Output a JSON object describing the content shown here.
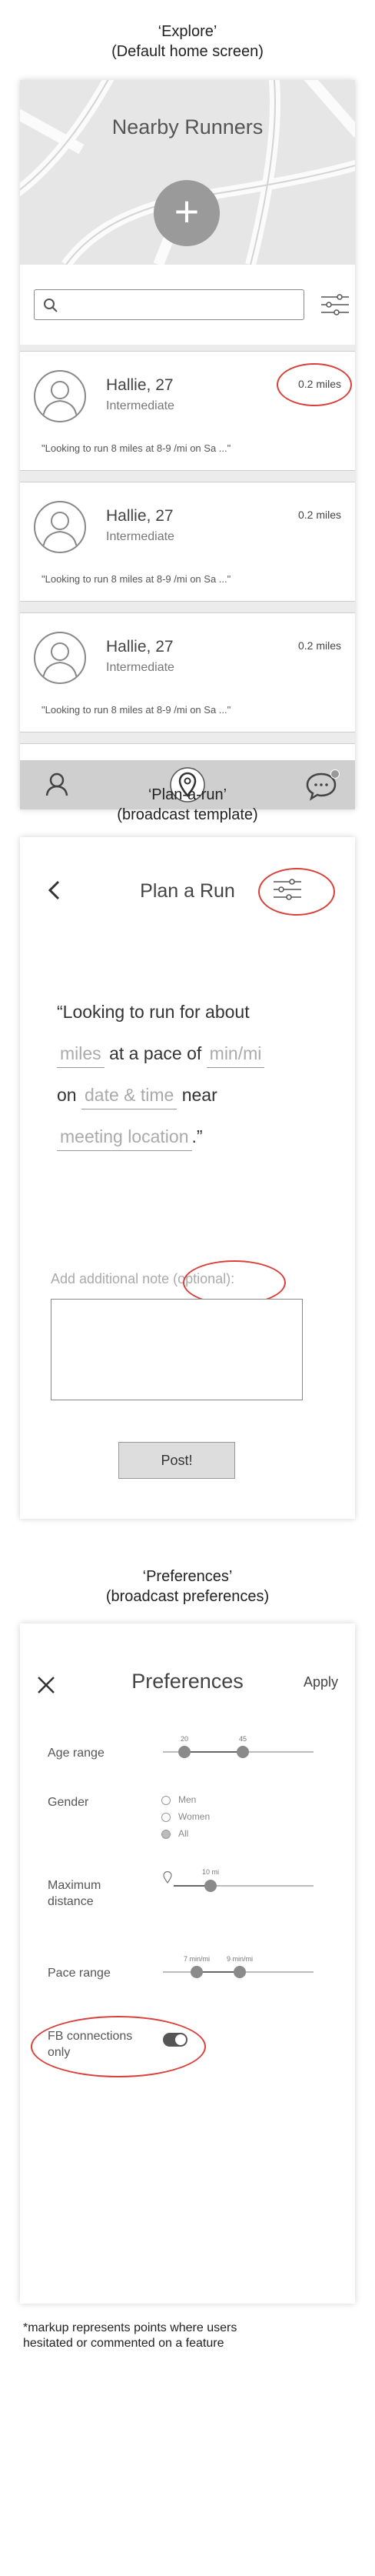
{
  "explore": {
    "caption_line1": "‘Explore’",
    "caption_line2": "(Default home screen)",
    "hero_title": "Nearby Runners",
    "add_label": "+",
    "search": {
      "placeholder": ""
    },
    "runners": [
      {
        "name": "Hallie, 27",
        "level": "Intermediate",
        "distance": "0.2 miles",
        "quote": "\"Looking to run 8 miles at 8-9 /mi on Sa ...\""
      },
      {
        "name": "Hallie, 27",
        "level": "Intermediate",
        "distance": "0.2 miles",
        "quote": "\"Looking to run 8 miles at 8-9 /mi on Sa ...\""
      },
      {
        "name": "Hallie, 27",
        "level": "Intermediate",
        "distance": "0.2 miles",
        "quote": "\"Looking to run 8 miles at 8-9 /mi on Sa ...\""
      }
    ],
    "tabs": [
      "user-icon",
      "location-pin-icon",
      "chat-icon"
    ]
  },
  "plan": {
    "caption_line1": "‘Plan-a-run’",
    "caption_line2": "(broadcast template)",
    "title": "Plan a Run",
    "quote": {
      "line1": "“Looking to run for about",
      "miles": "miles",
      "at_pace": "at a pace of",
      "pace": "min/mi",
      "on": "on",
      "date": "date & time",
      "near": "near",
      "location": "meeting location",
      "end": ".”"
    },
    "note_label": "Add additional note (optional):",
    "post_label": "Post!"
  },
  "prefs": {
    "caption_line1": "‘Preferences’",
    "caption_line2": "(broadcast preferences)",
    "title": "Preferences",
    "apply_label": "Apply",
    "age": {
      "label": "Age range",
      "min": "20",
      "max": "45"
    },
    "gender": {
      "label": "Gender",
      "options": [
        "Men",
        "Women",
        "All"
      ],
      "selected": "All"
    },
    "distance": {
      "label_1": "Maximum",
      "label_2": "distance",
      "value": "10 mi"
    },
    "pace": {
      "label": "Pace range",
      "min": "7 min/mi",
      "max": "9 min/mi"
    },
    "fb": {
      "label_1": "FB connections",
      "label_2": "only",
      "on": true
    }
  },
  "footnote": {
    "line1": "*markup represents points where users",
    "line2": "hesitated or commented on a feature"
  },
  "colors": {
    "markup": "#d9403a",
    "tabbar": "#cfcfcf",
    "fab": "#9a9a9a"
  }
}
